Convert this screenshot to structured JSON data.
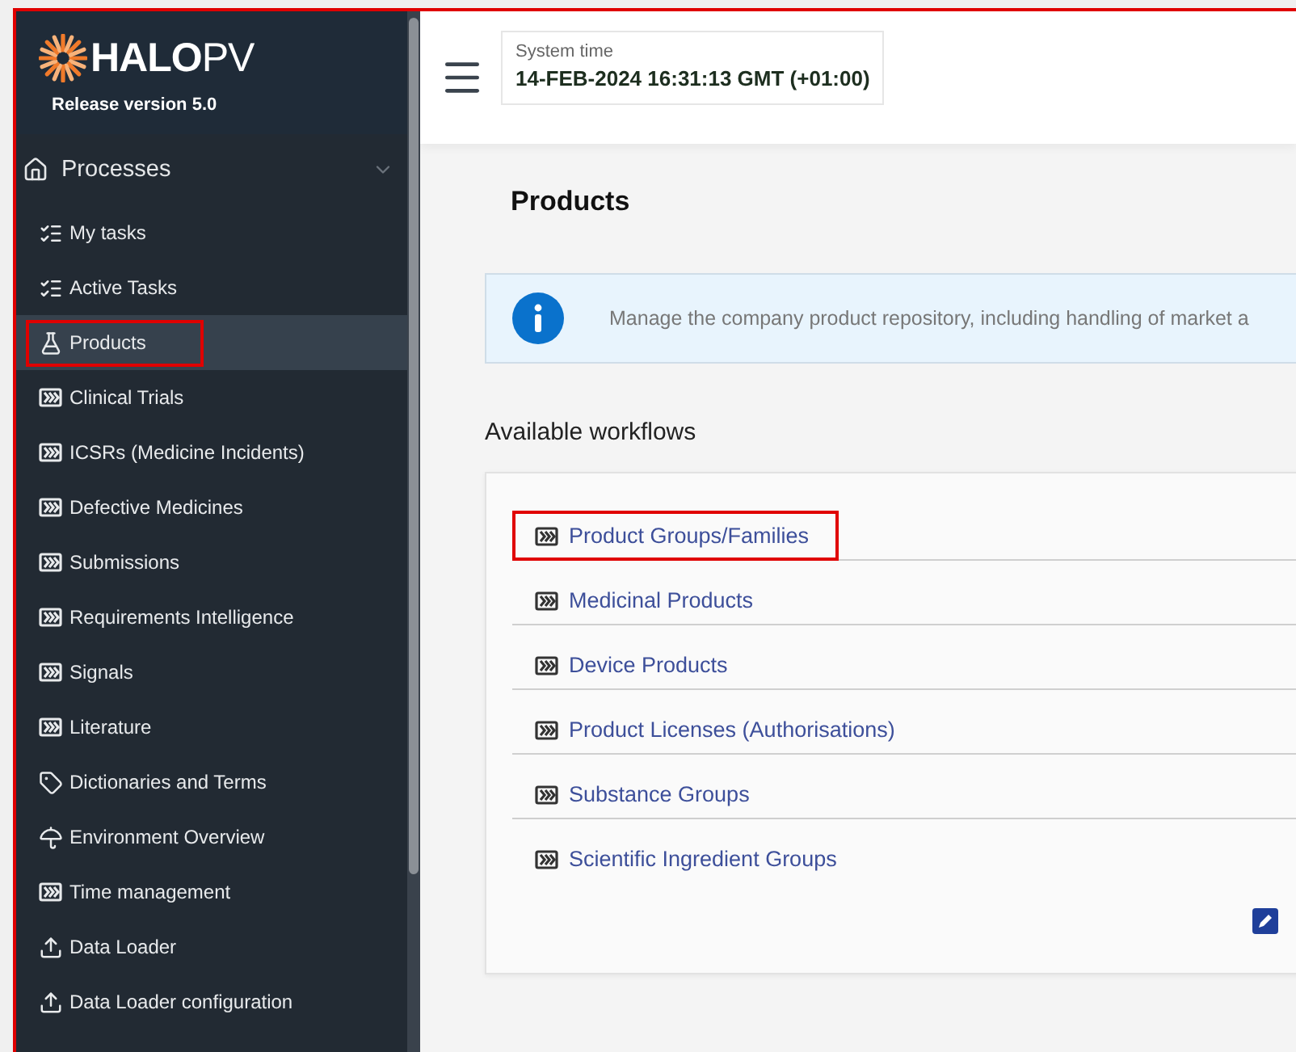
{
  "sidebar": {
    "logo": "**HALO**PV",
    "release": "Release version 5.0",
    "section": {
      "label": "Processes",
      "expanded": true
    },
    "items": [
      {
        "label": "My tasks",
        "kind": "tasks",
        "selected": false,
        "highlighted": false
      },
      {
        "label": "Active Tasks",
        "kind": "tasks",
        "selected": false,
        "highlighted": false
      },
      {
        "label": "Products",
        "kind": "flask",
        "selected": true,
        "highlighted": true
      },
      {
        "label": "Clinical Trials",
        "kind": "workflow",
        "selected": false,
        "highlighted": false
      },
      {
        "label": "ICSRs (Medicine Incidents)",
        "kind": "workflow",
        "selected": false,
        "highlighted": false
      },
      {
        "label": "Defective Medicines",
        "kind": "workflow",
        "selected": false,
        "highlighted": false
      },
      {
        "label": "Submissions",
        "kind": "workflow",
        "selected": false,
        "highlighted": false
      },
      {
        "label": "Requirements Intelligence",
        "kind": "workflow",
        "selected": false,
        "highlighted": false
      },
      {
        "label": "Signals",
        "kind": "workflow",
        "selected": false,
        "highlighted": false
      },
      {
        "label": "Literature",
        "kind": "workflow",
        "selected": false,
        "highlighted": false
      },
      {
        "label": "Dictionaries and Terms",
        "kind": "tag",
        "selected": false,
        "highlighted": false
      },
      {
        "label": "Environment Overview",
        "kind": "umbrella",
        "selected": false,
        "highlighted": false
      },
      {
        "label": "Time management",
        "kind": "workflow",
        "selected": false,
        "highlighted": false
      },
      {
        "label": "Data Loader",
        "kind": "upload",
        "selected": false,
        "highlighted": false
      },
      {
        "label": "Data Loader configuration",
        "kind": "upload",
        "selected": false,
        "highlighted": false
      }
    ]
  },
  "system_time": {
    "label": "System time",
    "value": "14-FEB-2024 16:31:13 GMT (+01:00)"
  },
  "page_title": "Products",
  "info_banner": "Manage the company product repository, including handling of market a",
  "workflows": {
    "heading": "Available workflows",
    "items": [
      {
        "label": "Product Groups/Families",
        "highlighted": true
      },
      {
        "label": "Medicinal Products",
        "highlighted": false
      },
      {
        "label": "Device Products",
        "highlighted": false
      },
      {
        "label": "Product Licenses (Authorisations)",
        "highlighted": false
      },
      {
        "label": "Substance Groups",
        "highlighted": false
      },
      {
        "label": "Scientific Ingredient Groups",
        "highlighted": false
      }
    ]
  }
}
